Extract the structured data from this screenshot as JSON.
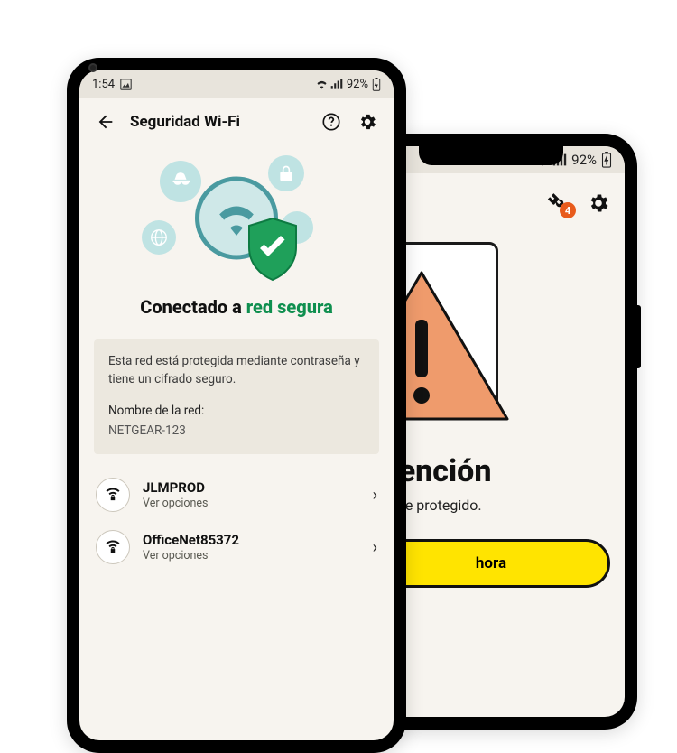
{
  "left": {
    "status": {
      "time": "1:54",
      "battery": "92%"
    },
    "header": {
      "title": "Seguridad Wi-Fi"
    },
    "hero": {
      "prefix": "Conectado a ",
      "secure": "red segura"
    },
    "info": {
      "desc": "Esta red está protegida mediante contraseña y tiene un cifrado seguro.",
      "net_label": "Nombre de la red:",
      "net_name": "NETGEAR-123"
    },
    "networks": [
      {
        "name": "JLMPROD",
        "sub": "Ver opciones"
      },
      {
        "name": "OfficeNet85372",
        "sub": "Ver opciones"
      }
    ]
  },
  "right": {
    "status": {
      "battery": "92%"
    },
    "tools_badge": "4",
    "title": "atención",
    "subtitle": "enerte protegido.",
    "cta": "hora"
  }
}
